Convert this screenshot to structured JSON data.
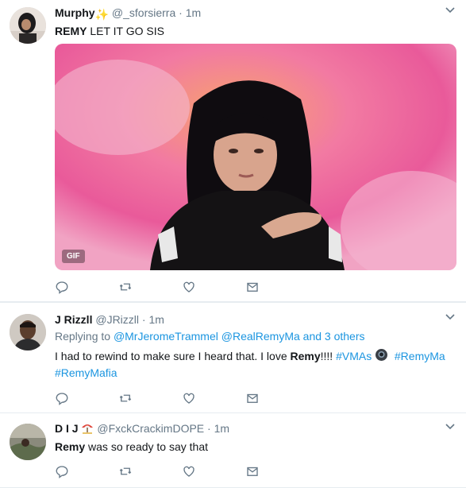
{
  "tweets": [
    {
      "display_name": "Murphy",
      "name_emoji": "✨",
      "handle": "@_sforsierra",
      "time": "1m",
      "text_bold": "REMY",
      "text_rest": " LET IT GO SIS",
      "media_badge": "GIF"
    },
    {
      "display_name": "J Rizzll",
      "handle": "@JRizzll",
      "time": "1m",
      "replying_prefix": "Replying to ",
      "replying_user1": "@MrJeromeTrammel",
      "replying_user2": "@RealRemyMa",
      "replying_suffix": " and 3 others",
      "text_part1": "I had to rewind to make sure I heard that. I love ",
      "text_bold": "Remy",
      "text_part2": "!!!! ",
      "hashtag1": "#VMAs",
      "hashtag2": "#RemyMa",
      "hashtag3": "#RemyMafia"
    },
    {
      "display_name": "D I J",
      "name_emoji": "⛱️",
      "handle": "@FxckCrackimDOPE",
      "time": "1m",
      "text_bold": "Remy",
      "text_rest": " was so ready to say that"
    }
  ],
  "ui": {
    "separator": "·",
    "more_icon": "chevron-down-icon",
    "icons": [
      "reply-icon",
      "retweet-icon",
      "like-icon",
      "direct-message-icon"
    ],
    "colors": {
      "link": "#1b95e0",
      "muted": "#657786",
      "text": "#14171a",
      "border": "#e6ecf0"
    }
  }
}
